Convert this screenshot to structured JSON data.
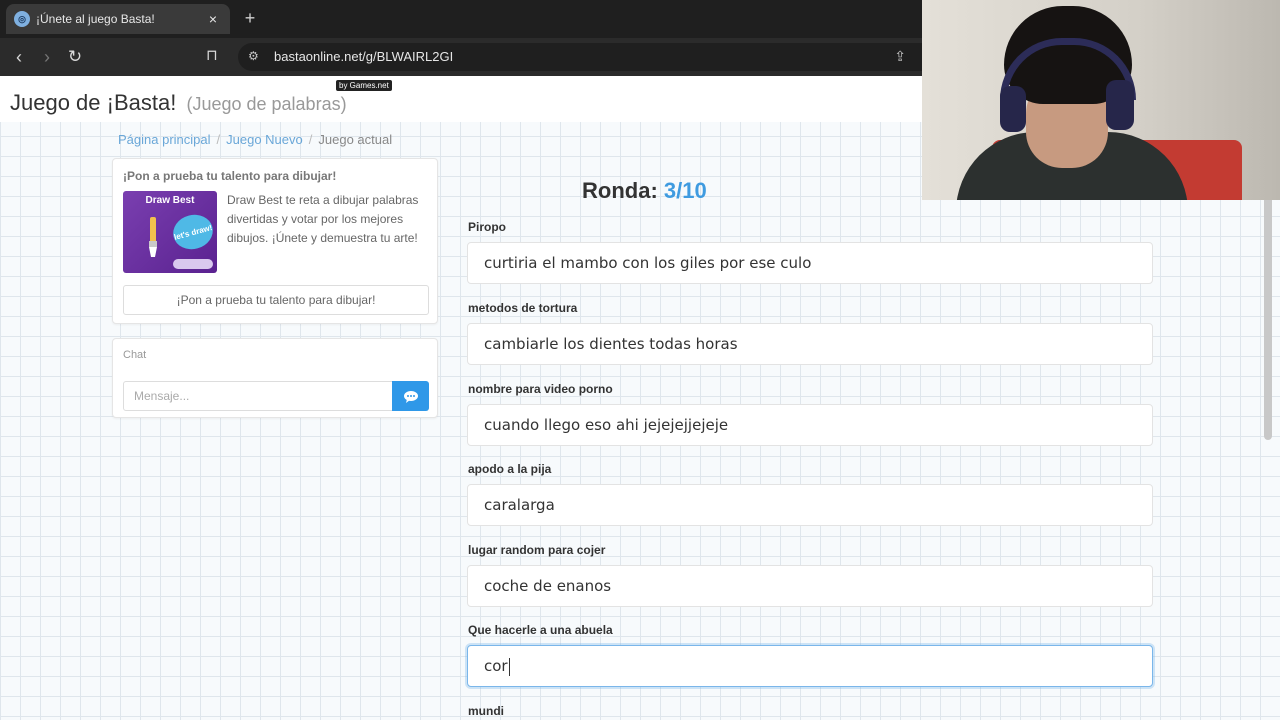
{
  "browser": {
    "tab_title": "¡Únete al juego Basta!",
    "tab_close": "×",
    "new_tab": "+",
    "url": "bastaonline.net/g/BLWAIRL2GI",
    "favicon": "globe-icon"
  },
  "header": {
    "title": "Juego de ¡Basta!",
    "subtitle": "(Juego de palabras)",
    "badge": "by Games.net"
  },
  "breadcrumb": {
    "items": [
      "Página principal",
      "Juego Nuevo",
      "Juego actual"
    ],
    "separator": "/"
  },
  "promo": {
    "heading": "¡Pon a prueba tu talento para dibujar!",
    "image_title": "Draw Best",
    "image_bubble": "let's draw!",
    "text": "Draw Best te reta a dibujar palabras divertidas y votar por los mejores dibujos. ¡Únete y demuestra tu arte!",
    "button": "¡Pon a prueba tu talento para dibujar!"
  },
  "chat": {
    "label": "Chat",
    "placeholder": "Mensaje...",
    "send_icon": "chat-bubble-icon"
  },
  "round": {
    "label": "Ronda:",
    "value": "3/10"
  },
  "fields": [
    {
      "label": "Piropo",
      "value": "curtiria el mambo con los giles por ese culo"
    },
    {
      "label": "metodos de tortura",
      "value": "cambiarle los dientes todas horas"
    },
    {
      "label": "nombre para video porno",
      "value": "cuando llego eso ahi jejejejjejeje"
    },
    {
      "label": "apodo a la pija",
      "value": "caralarga"
    },
    {
      "label": "lugar random para cojer",
      "value": "coche de enanos"
    },
    {
      "label": "Que hacerle a una abuela",
      "value": "cor"
    },
    {
      "label": "mundi",
      "value": ""
    }
  ],
  "colors": {
    "accent": "#3f9be0",
    "send_button": "#2f98e8",
    "promo_purple": "#7a3fb0"
  }
}
